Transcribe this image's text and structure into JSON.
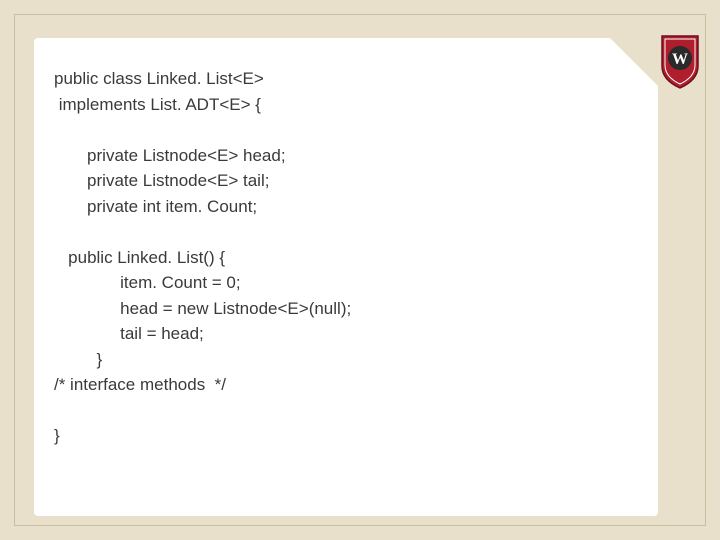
{
  "code": {
    "l1": "public class Linked. List<E>",
    "l2": " implements List. ADT<E> {",
    "l3": "",
    "l4": "       private Listnode<E> head;",
    "l5": "       private Listnode<E> tail;",
    "l6": "       private int item. Count;",
    "l7": "",
    "l8": "   public Linked. List() {",
    "l9": "              item. Count = 0;",
    "l10": "              head = new Listnode<E>(null);",
    "l11": "              tail = head;",
    "l12": "         }",
    "l13": "/* interface methods  */",
    "l14": "",
    "l15": "}"
  },
  "crest_letter": "W"
}
